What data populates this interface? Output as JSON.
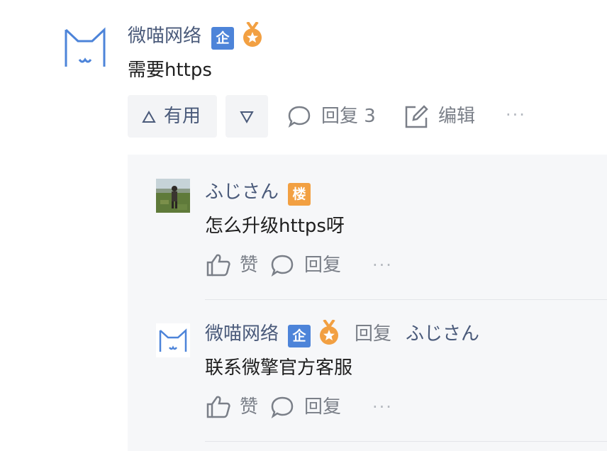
{
  "answer": {
    "author": "微喵网络",
    "badge": "企",
    "content": "需要https",
    "actions": {
      "upvote_label": "有用",
      "reply_label": "回复 3",
      "edit_label": "编辑",
      "more": "···"
    }
  },
  "comments": [
    {
      "author": "ふじさん",
      "badge": "楼",
      "content": "怎么升级https呀",
      "like_label": "赞",
      "reply_label": "回复",
      "more": "···"
    },
    {
      "author": "微喵网络",
      "badge": "企",
      "reply_word": "回复",
      "reply_to": "ふじさん",
      "content": "联系微擎官方客服",
      "like_label": "赞",
      "reply_label": "回复",
      "more": "···"
    }
  ],
  "colors": {
    "name": "#4a5a7a",
    "enterprise_badge": "#4d84d9",
    "op_badge": "#f2a042",
    "medal": "#f2a042",
    "logo_stroke": "#4d84d9"
  }
}
